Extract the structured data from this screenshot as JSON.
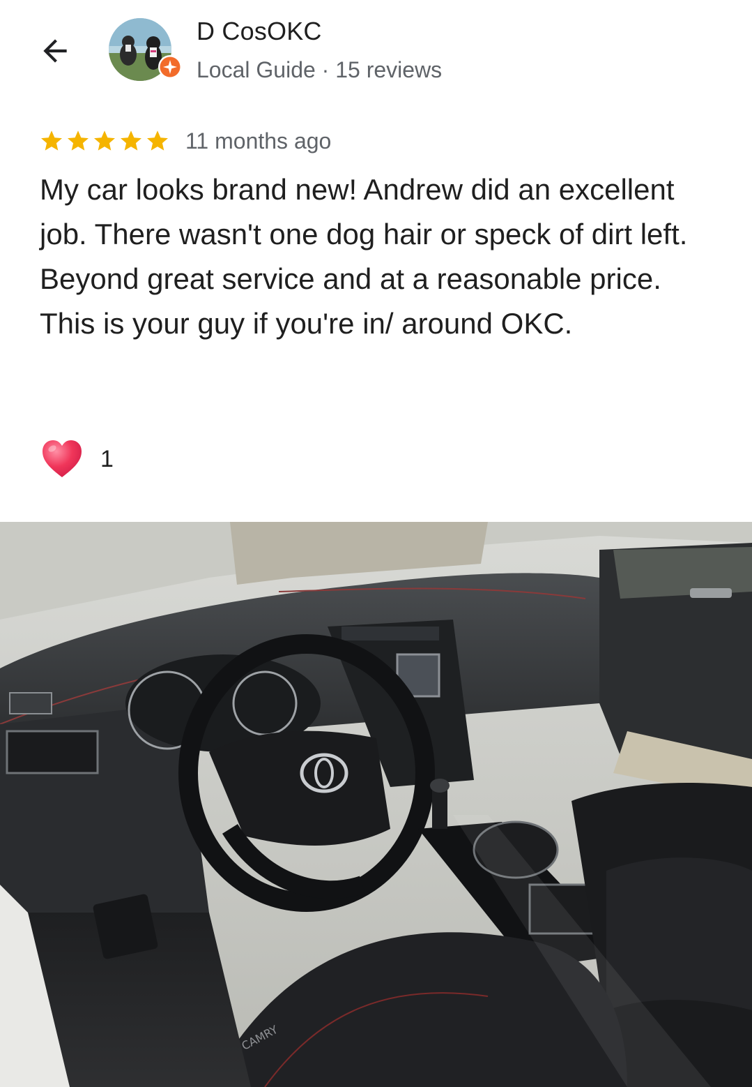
{
  "header": {
    "author_name": "D CosOKC",
    "author_meta": "Local Guide · 15 reviews"
  },
  "review": {
    "rating": 5,
    "rating_max": 5,
    "date": "11 months ago",
    "text": "My car looks brand new! Andrew did an excellent job. There wasn't one dog hair or speck of dirt left. Beyond great service and at a reasonable price. This is your guy if you're in/ around OKC.",
    "reaction_count": "1",
    "photo_badge": "CAMRY"
  },
  "icons": {
    "back": "arrow-back-icon",
    "badge": "local-guide-badge-icon",
    "star": "star-icon",
    "heart": "heart-icon"
  },
  "colors": {
    "star": "#F5B400",
    "badge": "#F26B2A",
    "heart": "#F0365A",
    "meta_text": "#5f6368",
    "body_text": "#1f1f1f"
  }
}
